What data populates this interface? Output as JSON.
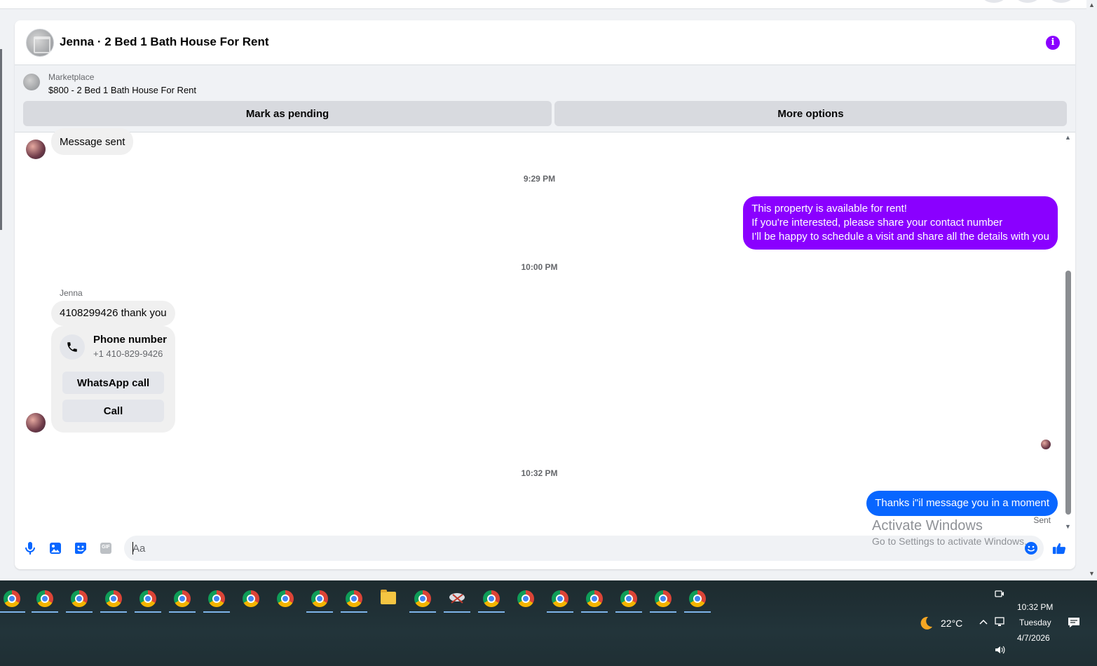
{
  "conversation": {
    "title": "Jenna · 2 Bed 1 Bath House For Rent",
    "info_icon": "info-icon"
  },
  "listing": {
    "source": "Marketplace",
    "title": "$800 - 2 Bed 1 Bath House For Rent",
    "pending_label": "Mark as pending",
    "more_label": "More options"
  },
  "messages": {
    "first_in": "Message sent",
    "time1": "9:29 PM",
    "out_purple": [
      "This property is available for rent!",
      "If you're interested, please share your contact number",
      "I'll be happy to schedule a visit and share all the details with you"
    ],
    "time2": "10:00 PM",
    "sender": "Jenna",
    "in_phone": "4108299426 thank you",
    "card": {
      "title": "Phone number",
      "number": "+1 410-829-9426",
      "whatsapp_label": "WhatsApp call",
      "call_label": "Call"
    },
    "time3": "10:32 PM",
    "out_blue": "Thanks i\"il message you in a moment",
    "status": "Sent"
  },
  "composer": {
    "placeholder": "Aa",
    "icons": [
      "microphone-icon",
      "image-icon",
      "sticker-icon",
      "gif-icon",
      "emoji-icon",
      "thumbs-up-icon"
    ],
    "gif_label": "GIF"
  },
  "watermark": {
    "line1": "Activate Windows",
    "line2": "Go to Settings to activate Windows."
  },
  "taskbar": {
    "weather": "22°C",
    "time": "10:32 PM",
    "day": "Tuesday",
    "date": "4/7/2026"
  },
  "colors": {
    "accent_purple": "#8a00ff",
    "accent_blue": "#0866ff",
    "bubble_gray": "#f0f0f0"
  }
}
